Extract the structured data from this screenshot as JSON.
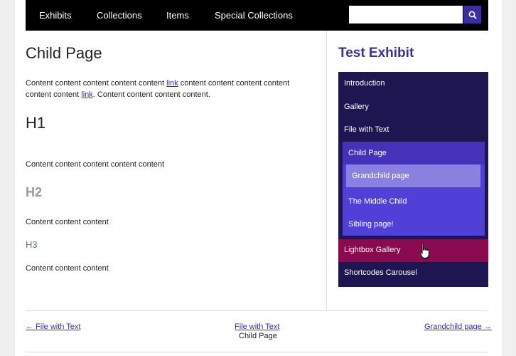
{
  "nav": {
    "items": [
      {
        "label": "Exhibits"
      },
      {
        "label": "Collections"
      },
      {
        "label": "Items"
      },
      {
        "label": "Special Collections"
      }
    ],
    "search_value": "",
    "search_icon": "search-icon"
  },
  "content": {
    "title": "Child Page",
    "para1_a": "Content content content content content ",
    "para1_link1": "link",
    "para1_b": " content content content content content content ",
    "para1_link2": "link",
    "para1_c": ". Content content content content.",
    "h1": "H1",
    "para2": "Content content content content content",
    "h2": "H2",
    "para3": "Content content content",
    "h3": "H3",
    "para4": "Content content content"
  },
  "sidebar": {
    "exhibit_title": "Test Exhibit",
    "items": [
      {
        "label": "Introduction"
      },
      {
        "label": "Gallery"
      },
      {
        "label": "File with Text"
      },
      {
        "label": "Child Page"
      },
      {
        "label": "Grandchild page"
      },
      {
        "label": "The Middle Child"
      },
      {
        "label": "Sibling page!"
      },
      {
        "label": "Lightbox Gallery"
      },
      {
        "label": "Shortcodes Carousel"
      }
    ]
  },
  "pager": {
    "prev": "← File with Text",
    "up": "File with Text",
    "current": "Child Page",
    "next": "Grandchild page →"
  },
  "colors": {
    "accent": "#3a2fa0",
    "nav_bg": "#1e1650",
    "hover_bg": "#8a0a50"
  }
}
